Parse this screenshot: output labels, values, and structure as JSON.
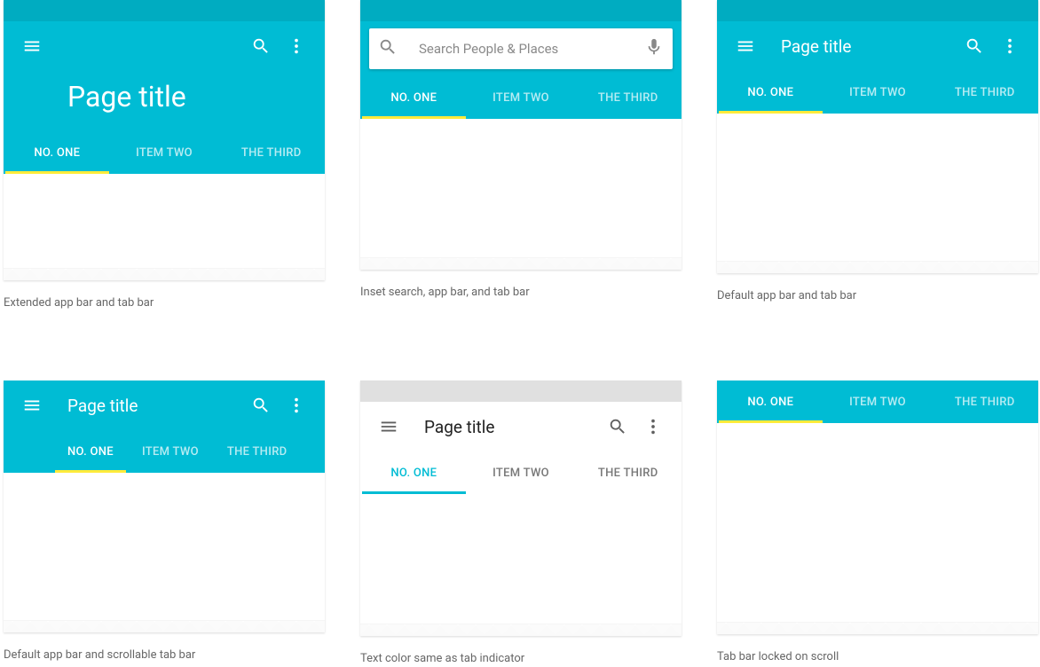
{
  "colors": {
    "teal": "#00bcd4",
    "teal_dark": "#00acc1",
    "accent": "#ffeb3b"
  },
  "common": {
    "page_title": "Page title",
    "tabs": [
      "NO. ONE",
      "ITEM TWO",
      "THE THIRD"
    ],
    "search_placeholder": "Search People  & Places"
  },
  "examples": [
    {
      "id": "extended",
      "caption": "Extended app bar and tab bar"
    },
    {
      "id": "inset",
      "caption": "Inset search, app bar, and tab bar"
    },
    {
      "id": "default",
      "caption": "Default app bar and tab bar"
    },
    {
      "id": "scrollable",
      "caption": "Default app bar and scrollable tab bar"
    },
    {
      "id": "textcolor",
      "caption": "Text color same as tab indicator"
    },
    {
      "id": "locked",
      "caption": "Tab bar locked on scroll"
    }
  ]
}
